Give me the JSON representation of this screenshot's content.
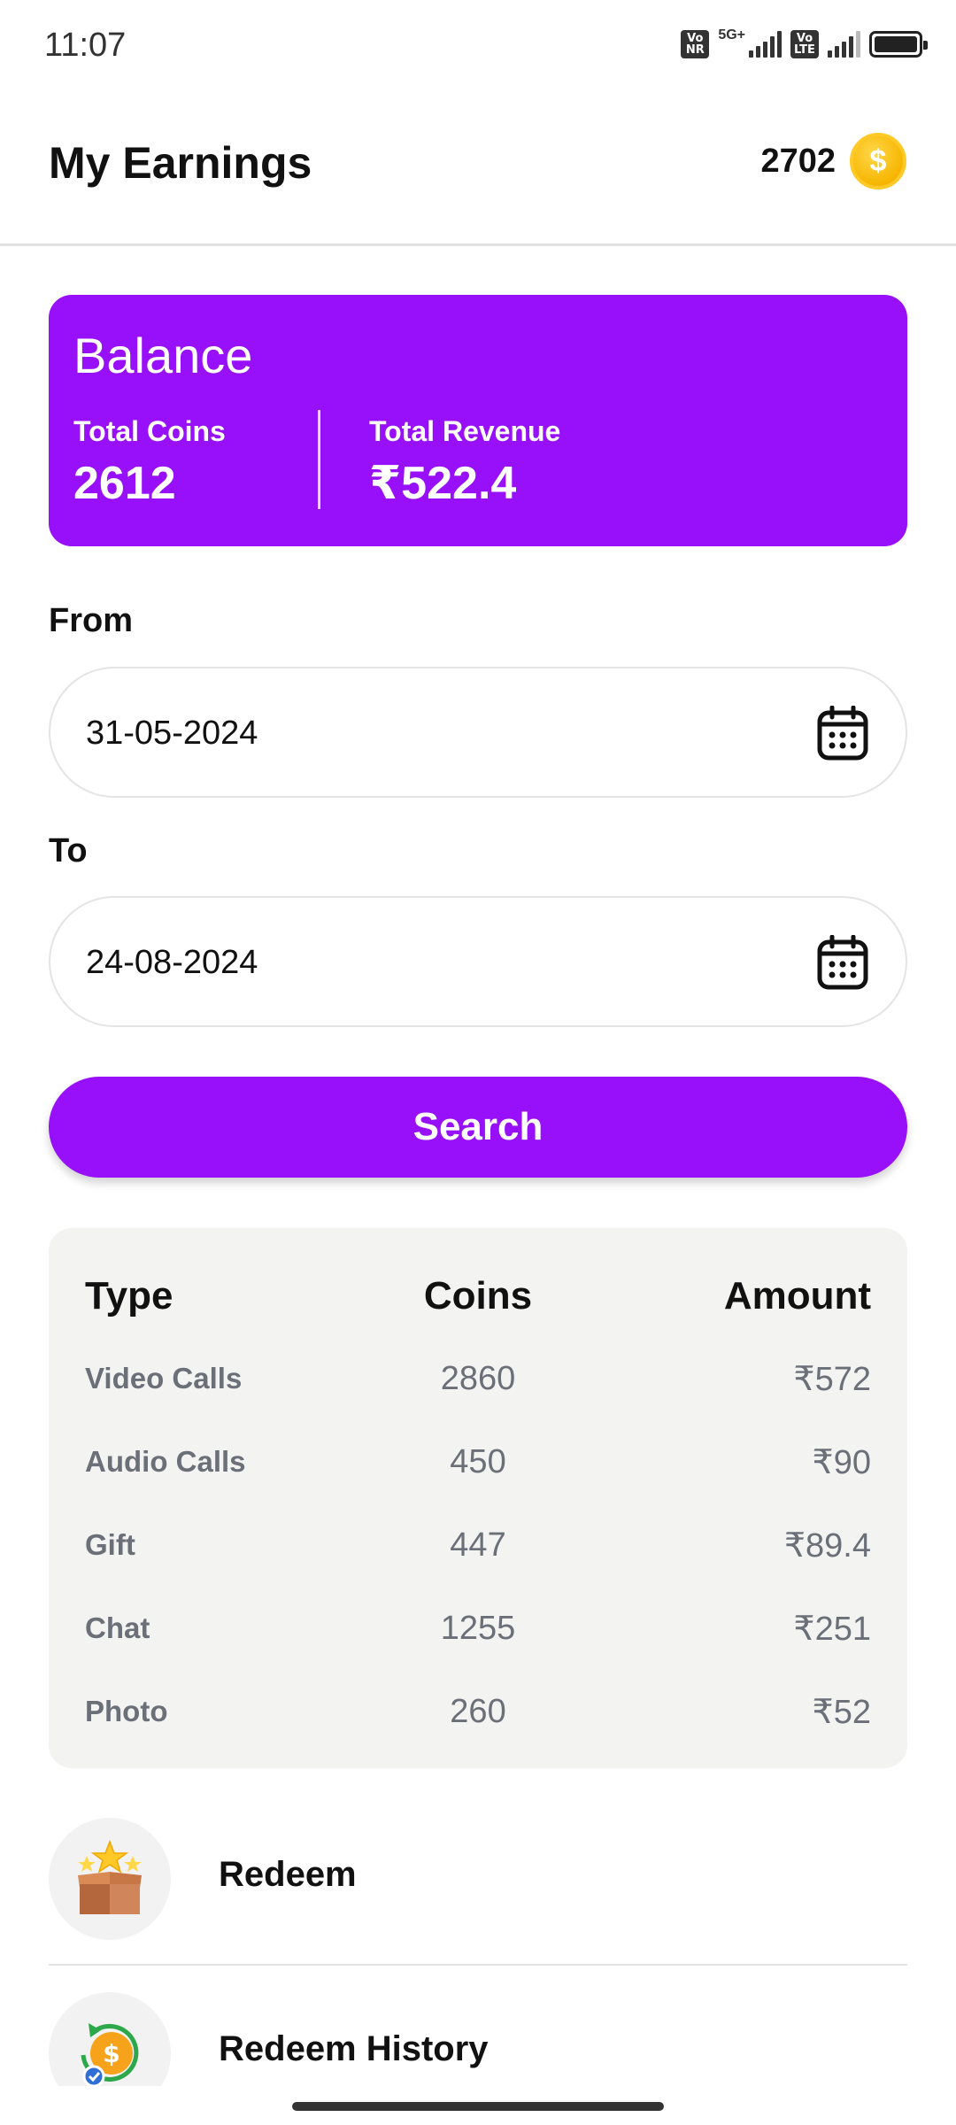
{
  "status_bar": {
    "time": "11:07",
    "chip_1": "Vo NR",
    "network": "5G+",
    "chip_2": "Vo LTE"
  },
  "header": {
    "title": "My Earnings",
    "coins": "2702"
  },
  "balance": {
    "title": "Balance",
    "total_coins_label": "Total Coins",
    "total_coins_value": "2612",
    "total_revenue_label": "Total Revenue",
    "total_revenue_value": "₹522.4"
  },
  "from": {
    "label": "From",
    "value": "31-05-2024"
  },
  "to": {
    "label": "To",
    "value": "24-08-2024"
  },
  "search_button": "Search",
  "table": {
    "headers": [
      "Type",
      "Coins",
      "Amount"
    ],
    "rows": [
      {
        "type": "Video Calls",
        "coins": "2860",
        "amount": "₹572"
      },
      {
        "type": "Audio Calls",
        "coins": "450",
        "amount": "₹90"
      },
      {
        "type": "Gift",
        "coins": "447",
        "amount": "₹89.4"
      },
      {
        "type": "Chat",
        "coins": "1255",
        "amount": "₹251"
      },
      {
        "type": "Photo",
        "coins": "260",
        "amount": "₹52"
      }
    ]
  },
  "menu": [
    {
      "label": "Redeem",
      "icon": "gift-box-stars-icon"
    },
    {
      "label": "Redeem History",
      "icon": "coin-history-icon"
    }
  ],
  "colors": {
    "accent": "#9810fa",
    "coin": "#f7b500",
    "table_bg": "#f3f3f2",
    "muted_text": "#6b6f78"
  }
}
